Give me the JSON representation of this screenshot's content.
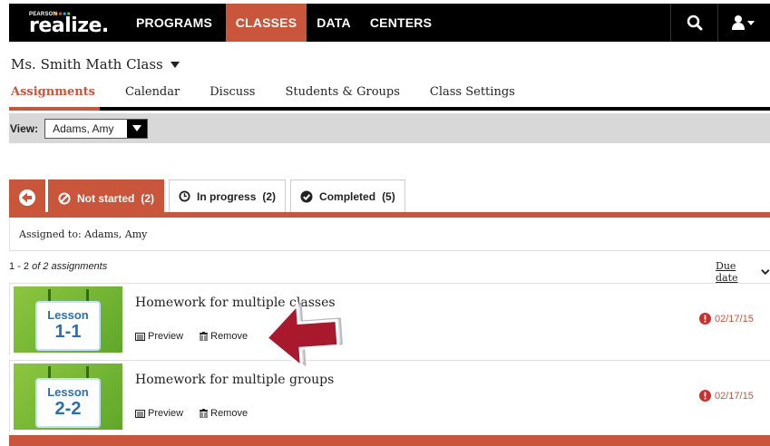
{
  "brand": {
    "sub": "PEARSON",
    "name": "realize."
  },
  "nav": {
    "items": [
      {
        "label": "PROGRAMS",
        "active": false
      },
      {
        "label": "CLASSES",
        "active": true
      },
      {
        "label": "DATA",
        "active": false
      },
      {
        "label": "CENTERS",
        "active": false
      }
    ],
    "search_icon": "search-icon",
    "user_icon": "user-menu-icon"
  },
  "class": {
    "title": "Ms. Smith Math Class",
    "tabs": [
      {
        "label": "Assignments",
        "active": true
      },
      {
        "label": "Calendar",
        "active": false
      },
      {
        "label": "Discuss",
        "active": false
      },
      {
        "label": "Students & Groups",
        "active": false
      },
      {
        "label": "Class Settings",
        "active": false
      }
    ]
  },
  "view": {
    "label": "View:",
    "selected": "Adams, Amy"
  },
  "status_tabs": [
    {
      "label": "Not started",
      "count": "(2)",
      "active": true
    },
    {
      "label": "In progress",
      "count": "(2)",
      "active": false
    },
    {
      "label": "Completed",
      "count": "(5)",
      "active": false
    }
  ],
  "assigned_to": "Assigned to: Adams, Amy",
  "list": {
    "range": "1 - 2",
    "of_text": "of 2 assignments",
    "sort_label": "Due date"
  },
  "assignments": [
    {
      "title": "Homework for multiple classes",
      "thumb_line1": "Lesson",
      "thumb_line2": "1-1",
      "preview": "Preview",
      "remove": "Remove",
      "due": "02/17/15"
    },
    {
      "title": "Homework for multiple groups",
      "thumb_line1": "Lesson",
      "thumb_line2": "2-2",
      "preview": "Preview",
      "remove": "Remove",
      "due": "02/17/15"
    }
  ],
  "colors": {
    "accent": "#c9553a",
    "nav_bg": "#000000",
    "thumb_green": "#8dc63f",
    "lesson_blue": "#2a6fb6"
  }
}
